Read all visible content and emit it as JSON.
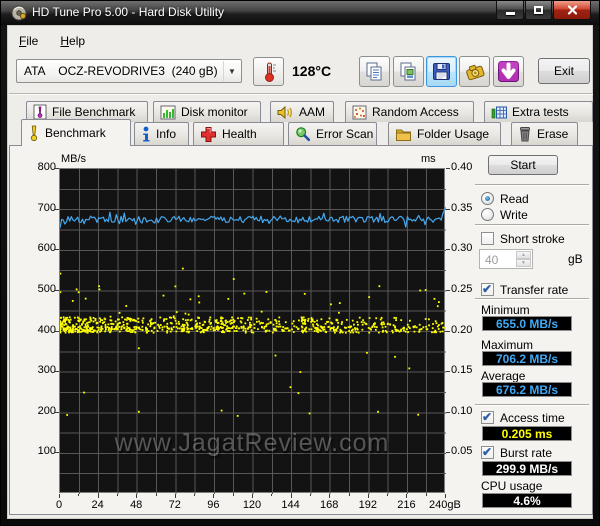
{
  "window": {
    "title": "HD Tune Pro 5.00 - Hard Disk Utility",
    "menu": {
      "file": "File",
      "help": "Help"
    }
  },
  "toolbar": {
    "drive_select": "ATA    OCZ-REVODRIVE3  (240 gB)",
    "temperature": "128°C",
    "exit": "Exit",
    "icons": {
      "copy_report": "copy-report-icon",
      "copy_image": "copy-image-icon",
      "save": "save-icon",
      "capture": "capture-icon",
      "download": "download-icon",
      "temperature": "thermometer-icon"
    }
  },
  "tabs_top": [
    {
      "label": "File Benchmark",
      "icon": "file-benchmark-icon"
    },
    {
      "label": "Disk monitor",
      "icon": "disk-monitor-icon"
    },
    {
      "label": "AAM",
      "icon": "aam-icon"
    },
    {
      "label": "Random Access",
      "icon": "random-access-icon"
    },
    {
      "label": "Extra tests",
      "icon": "extra-tests-icon"
    }
  ],
  "tabs_bottom": [
    {
      "label": "Benchmark",
      "icon": "benchmark-icon",
      "active": true
    },
    {
      "label": "Info",
      "icon": "info-icon",
      "active": false
    },
    {
      "label": "Health",
      "icon": "health-icon",
      "active": false
    },
    {
      "label": "Error Scan",
      "icon": "error-scan-icon",
      "active": false
    },
    {
      "label": "Folder Usage",
      "icon": "folder-usage-icon",
      "active": false
    },
    {
      "label": "Erase",
      "icon": "erase-icon",
      "active": false
    }
  ],
  "controls": {
    "start": "Start",
    "read": "Read",
    "write": "Write",
    "read_selected": true,
    "write_selected": false,
    "short_stroke": "Short stroke",
    "short_stroke_checked": false,
    "stroke_size": "40",
    "stroke_unit": "gB",
    "transfer_rate": "Transfer rate",
    "transfer_rate_checked": true,
    "minimum_label": "Minimum",
    "minimum_value": "655.0 MB/s",
    "maximum_label": "Maximum",
    "maximum_value": "706.2 MB/s",
    "average_label": "Average",
    "average_value": "676.2 MB/s",
    "access_time": "Access time",
    "access_time_checked": true,
    "access_time_value": "0.205 ms",
    "burst_rate": "Burst rate",
    "burst_rate_checked": true,
    "burst_rate_value": "299.9 MB/s",
    "cpu_usage_label": "CPU usage",
    "cpu_usage_value": "4.6%"
  },
  "watermark": "www.JagatReview.com",
  "chart_data": {
    "type": "line+scatter",
    "x_axis": {
      "ticks": [
        0,
        24,
        48,
        72,
        96,
        120,
        144,
        168,
        192,
        216
      ],
      "last_tick": "240gB",
      "max": 240,
      "grid_step": 12
    },
    "y_left": {
      "label": "MB/s",
      "ticks": [
        800,
        700,
        600,
        500,
        400,
        300,
        200,
        100
      ],
      "max": 800,
      "grid_step": 50
    },
    "y_right": {
      "label": "ms",
      "ticks": [
        "0.40",
        "0.35",
        "0.30",
        "0.25",
        "0.20",
        "0.15",
        "0.10",
        "0.05"
      ],
      "max": 0.4
    },
    "series": [
      {
        "name": "transfer-rate-line",
        "axis": "left",
        "unit": "MB/s",
        "min": 655.0,
        "max": 706.2,
        "average": 676.2
      },
      {
        "name": "access-time-scatter",
        "axis": "right",
        "unit": "ms",
        "average": 0.205
      }
    ],
    "summary": {
      "minimum_mbs": 655.0,
      "maximum_mbs": 706.2,
      "average_mbs": 676.2,
      "access_time_ms": 0.205,
      "burst_rate_mbs": 299.9,
      "cpu_usage_pct": 4.6
    },
    "colors": {
      "line": "#44A8F0",
      "scatter": "#FFFF00",
      "grid": "#575757",
      "plot_bg": "#131313",
      "value_blue": "#3FA9F5",
      "value_yellow": "#FFFF00",
      "value_white": "#FFFFFF"
    },
    "synthesis": {
      "seed": 7,
      "line": {
        "start": 655,
        "base": 676,
        "noise": 8,
        "spike_chance": 0.14,
        "spike_extra": 13,
        "clamp_min": 655,
        "clamp_max": 700,
        "end_values": [
          690,
          698,
          706.2
        ]
      },
      "scatter_bands": [
        {
          "count": 500,
          "x_power": 1.5,
          "center_ms": 0.2025,
          "jitter_ms": 0.004
        },
        {
          "count": 320,
          "x_power": 1.4,
          "center_ms": 0.2125,
          "jitter_ms": 0.005
        }
      ],
      "scatter_outliers": [
        {
          "count": 36,
          "min_ms": 0.217,
          "max_ms": 0.256,
          "x_power": 1.3
        },
        {
          "count": 10,
          "min_ms": 0.095,
          "max_ms": 0.135,
          "x_power": 1.0
        },
        {
          "count": 6,
          "min_ms": 0.14,
          "max_ms": 0.185,
          "x_power": 1.0
        },
        {
          "count": 3,
          "min_ms": 0.26,
          "max_ms": 0.295,
          "x_power": 1.5
        }
      ]
    }
  }
}
